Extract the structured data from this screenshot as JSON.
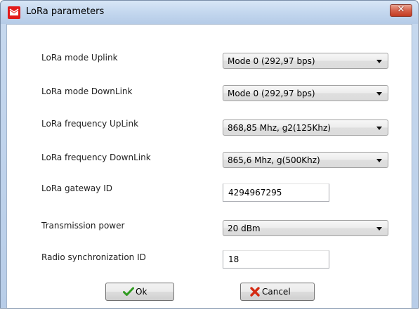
{
  "window": {
    "title": "LoRa parameters",
    "close_label": "✕"
  },
  "fields": [
    {
      "label": "LoRa mode Uplink",
      "value": "Mode 0 (292,97 bps)"
    },
    {
      "label": "LoRa mode DownLink",
      "value": "Mode 0 (292,97 bps)"
    },
    {
      "label": "LoRa frequency UpLink",
      "value": "868,85 Mhz, g2(125Khz)"
    },
    {
      "label": "LoRa frequency DownLink",
      "value": "865,6 Mhz, g(500Khz)"
    },
    {
      "label": "LoRa gateway ID",
      "value": "4294967295"
    },
    {
      "label": "Transmission power",
      "value": "20 dBm"
    },
    {
      "label": "Radio synchronization ID",
      "value": "18"
    }
  ],
  "buttons": {
    "ok_label": "Ok",
    "cancel_label": "Cancel"
  },
  "icons": {
    "app": "app-icon",
    "ok": "checkmark-icon",
    "cancel": "cancel-x-icon",
    "dropdown": "chevron-down-icon"
  },
  "colors": {
    "titlebar": "#c2d6ee",
    "close": "#c23b22",
    "ok_check": "#2e9a1e",
    "cancel_x": "#d42a12"
  }
}
